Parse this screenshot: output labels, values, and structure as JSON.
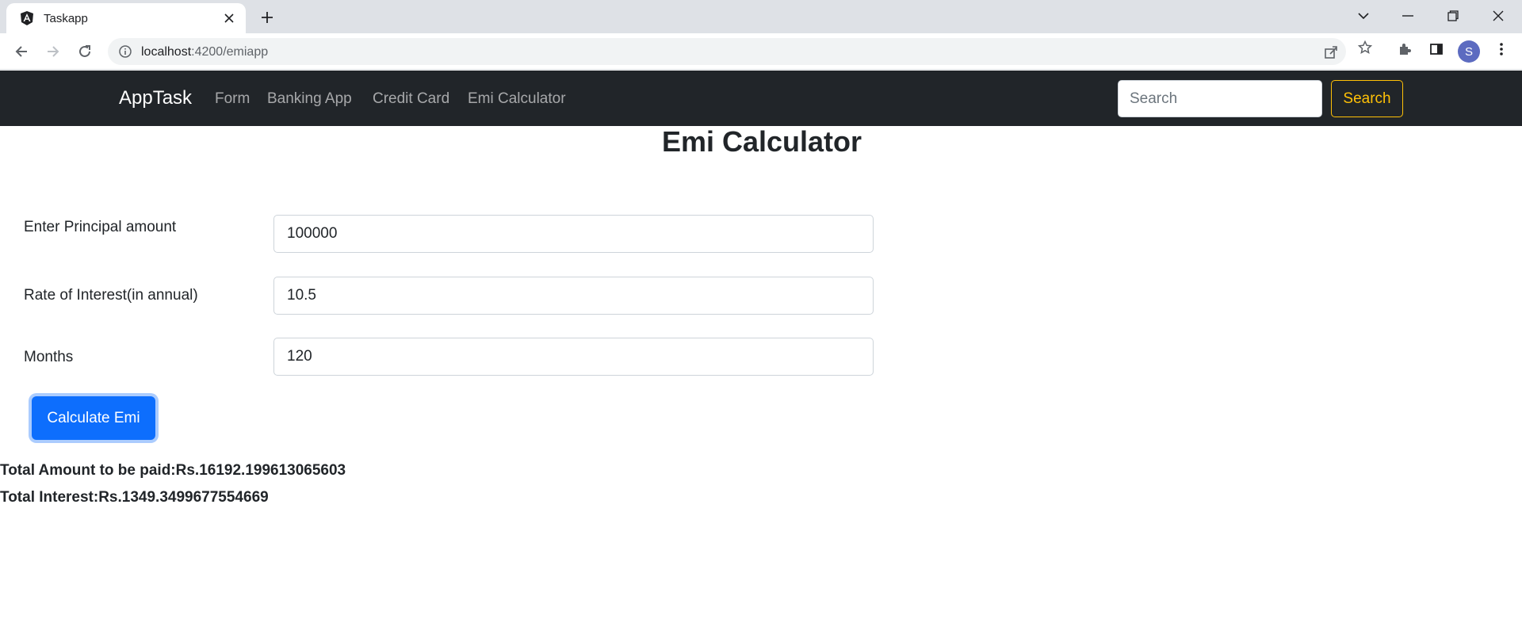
{
  "browser": {
    "tab_title": "Taskapp",
    "url_host": "localhost",
    "url_path": ":4200/emiapp",
    "profile_initial": "S"
  },
  "navbar": {
    "brand": "AppTask",
    "links": [
      "Form",
      "Banking App",
      "Credit Card",
      "Emi Calculator"
    ],
    "search_placeholder": "Search",
    "search_button": "Search"
  },
  "page": {
    "title": "Emi Calculator"
  },
  "form": {
    "principal_label": "Enter Principal amount",
    "principal_value": "100000",
    "rate_label": "Rate of Interest(in annual)",
    "rate_value": "10.5",
    "months_label": "Months",
    "months_value": "120",
    "submit_label": "Calculate Emi"
  },
  "results": {
    "total_amount": "Total Amount to be paid:Rs.16192.199613065603",
    "total_interest": "Total Interest:Rs.1349.3499677554669"
  },
  "colors": {
    "navbar_bg": "#212529",
    "primary": "#0d6efd",
    "warning": "#ffc107"
  }
}
